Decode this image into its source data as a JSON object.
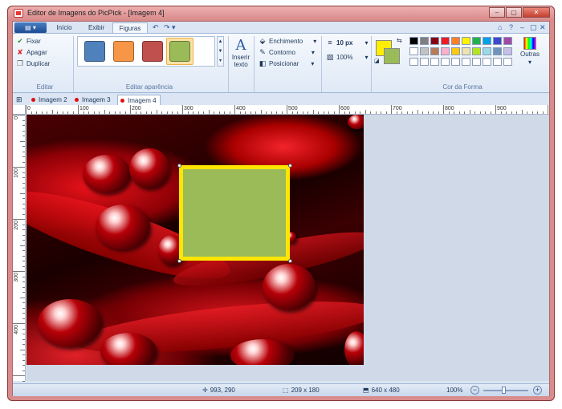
{
  "window": {
    "title": "Editor de Imagens do PicPick - [Imagem 4]",
    "buttons": {
      "minimize": "–",
      "maximize": "▢",
      "close": "✕"
    }
  },
  "ribbon_tabs": {
    "app_menu": "▤ ▾",
    "items": [
      "Início",
      "Exibir",
      "Figuras"
    ],
    "active": "Figuras",
    "qat_undo": "↶",
    "qat_redo": "↷ ▾",
    "help_icons": [
      "⌂",
      "?",
      "–",
      "▢",
      "✕"
    ]
  },
  "editar_group": {
    "fixar": "Fixar",
    "apagar": "Apagar",
    "duplicar": "Duplicar",
    "label": "Editar"
  },
  "aparencia_group": {
    "label": "Editar aparência",
    "styles": [
      "#4f81bd",
      "#f79646",
      "#c0504d",
      "#9bbb59"
    ],
    "selected_style": 3
  },
  "inserir_texto": {
    "icon": "A",
    "label1": "Inserir",
    "label2": "texto"
  },
  "format_group": {
    "enchimento": "Enchimento",
    "contorno": "Contorno",
    "posicionar": "Posicionar"
  },
  "size_group": {
    "line_width": "10 px",
    "opacity": "100%"
  },
  "cor_forma": {
    "label": "Cor da Forma",
    "color1": "#ffee00",
    "color2": "#9bbb59",
    "outras": "Outras",
    "palette_row1": [
      "#000000",
      "#7f7f7f",
      "#880015",
      "#ed1c24",
      "#ff7f27",
      "#fff200",
      "#22b14c",
      "#00a2e8",
      "#3f48cc",
      "#a349a4"
    ],
    "palette_row2": [
      "#ffffff",
      "#c3c3c3",
      "#b97a57",
      "#ffaec9",
      "#ffc90e",
      "#efe4b0",
      "#b5e61d",
      "#99d9ea",
      "#7092be",
      "#c8bfe7"
    ],
    "palette_row3": [
      "#ffffff",
      "#ffffff",
      "#ffffff",
      "#ffffff",
      "#ffffff",
      "#ffffff",
      "#ffffff",
      "#ffffff",
      "#ffffff",
      "#ffffff"
    ]
  },
  "doc_tabs": {
    "items": [
      "Imagem 2",
      "Imagem 3",
      "Imagem 4"
    ],
    "active": "Imagem 4"
  },
  "ruler": {
    "h_labels": [
      "0",
      "100",
      "200",
      "300",
      "400",
      "500",
      "600",
      "700",
      "800",
      "900"
    ],
    "v_labels": [
      "0",
      "100",
      "200",
      "300",
      "400"
    ]
  },
  "status": {
    "cursor": "993, 290",
    "selection": "209 x 180",
    "image_size": "640 x 480",
    "zoom": "100%",
    "zoom_out": "−",
    "zoom_in": "+"
  }
}
